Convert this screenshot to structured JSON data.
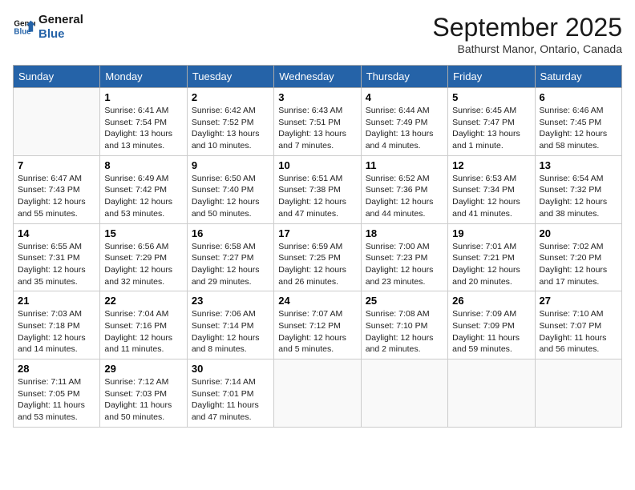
{
  "logo": {
    "line1": "General",
    "line2": "Blue"
  },
  "title": "September 2025",
  "subtitle": "Bathurst Manor, Ontario, Canada",
  "days": [
    "Sunday",
    "Monday",
    "Tuesday",
    "Wednesday",
    "Thursday",
    "Friday",
    "Saturday"
  ],
  "weeks": [
    [
      {
        "date": "",
        "content": ""
      },
      {
        "date": "1",
        "content": "Sunrise: 6:41 AM\nSunset: 7:54 PM\nDaylight: 13 hours\nand 13 minutes."
      },
      {
        "date": "2",
        "content": "Sunrise: 6:42 AM\nSunset: 7:52 PM\nDaylight: 13 hours\nand 10 minutes."
      },
      {
        "date": "3",
        "content": "Sunrise: 6:43 AM\nSunset: 7:51 PM\nDaylight: 13 hours\nand 7 minutes."
      },
      {
        "date": "4",
        "content": "Sunrise: 6:44 AM\nSunset: 7:49 PM\nDaylight: 13 hours\nand 4 minutes."
      },
      {
        "date": "5",
        "content": "Sunrise: 6:45 AM\nSunset: 7:47 PM\nDaylight: 13 hours\nand 1 minute."
      },
      {
        "date": "6",
        "content": "Sunrise: 6:46 AM\nSunset: 7:45 PM\nDaylight: 12 hours\nand 58 minutes."
      }
    ],
    [
      {
        "date": "7",
        "content": "Sunrise: 6:47 AM\nSunset: 7:43 PM\nDaylight: 12 hours\nand 55 minutes."
      },
      {
        "date": "8",
        "content": "Sunrise: 6:49 AM\nSunset: 7:42 PM\nDaylight: 12 hours\nand 53 minutes."
      },
      {
        "date": "9",
        "content": "Sunrise: 6:50 AM\nSunset: 7:40 PM\nDaylight: 12 hours\nand 50 minutes."
      },
      {
        "date": "10",
        "content": "Sunrise: 6:51 AM\nSunset: 7:38 PM\nDaylight: 12 hours\nand 47 minutes."
      },
      {
        "date": "11",
        "content": "Sunrise: 6:52 AM\nSunset: 7:36 PM\nDaylight: 12 hours\nand 44 minutes."
      },
      {
        "date": "12",
        "content": "Sunrise: 6:53 AM\nSunset: 7:34 PM\nDaylight: 12 hours\nand 41 minutes."
      },
      {
        "date": "13",
        "content": "Sunrise: 6:54 AM\nSunset: 7:32 PM\nDaylight: 12 hours\nand 38 minutes."
      }
    ],
    [
      {
        "date": "14",
        "content": "Sunrise: 6:55 AM\nSunset: 7:31 PM\nDaylight: 12 hours\nand 35 minutes."
      },
      {
        "date": "15",
        "content": "Sunrise: 6:56 AM\nSunset: 7:29 PM\nDaylight: 12 hours\nand 32 minutes."
      },
      {
        "date": "16",
        "content": "Sunrise: 6:58 AM\nSunset: 7:27 PM\nDaylight: 12 hours\nand 29 minutes."
      },
      {
        "date": "17",
        "content": "Sunrise: 6:59 AM\nSunset: 7:25 PM\nDaylight: 12 hours\nand 26 minutes."
      },
      {
        "date": "18",
        "content": "Sunrise: 7:00 AM\nSunset: 7:23 PM\nDaylight: 12 hours\nand 23 minutes."
      },
      {
        "date": "19",
        "content": "Sunrise: 7:01 AM\nSunset: 7:21 PM\nDaylight: 12 hours\nand 20 minutes."
      },
      {
        "date": "20",
        "content": "Sunrise: 7:02 AM\nSunset: 7:20 PM\nDaylight: 12 hours\nand 17 minutes."
      }
    ],
    [
      {
        "date": "21",
        "content": "Sunrise: 7:03 AM\nSunset: 7:18 PM\nDaylight: 12 hours\nand 14 minutes."
      },
      {
        "date": "22",
        "content": "Sunrise: 7:04 AM\nSunset: 7:16 PM\nDaylight: 12 hours\nand 11 minutes."
      },
      {
        "date": "23",
        "content": "Sunrise: 7:06 AM\nSunset: 7:14 PM\nDaylight: 12 hours\nand 8 minutes."
      },
      {
        "date": "24",
        "content": "Sunrise: 7:07 AM\nSunset: 7:12 PM\nDaylight: 12 hours\nand 5 minutes."
      },
      {
        "date": "25",
        "content": "Sunrise: 7:08 AM\nSunset: 7:10 PM\nDaylight: 12 hours\nand 2 minutes."
      },
      {
        "date": "26",
        "content": "Sunrise: 7:09 AM\nSunset: 7:09 PM\nDaylight: 11 hours\nand 59 minutes."
      },
      {
        "date": "27",
        "content": "Sunrise: 7:10 AM\nSunset: 7:07 PM\nDaylight: 11 hours\nand 56 minutes."
      }
    ],
    [
      {
        "date": "28",
        "content": "Sunrise: 7:11 AM\nSunset: 7:05 PM\nDaylight: 11 hours\nand 53 minutes."
      },
      {
        "date": "29",
        "content": "Sunrise: 7:12 AM\nSunset: 7:03 PM\nDaylight: 11 hours\nand 50 minutes."
      },
      {
        "date": "30",
        "content": "Sunrise: 7:14 AM\nSunset: 7:01 PM\nDaylight: 11 hours\nand 47 minutes."
      },
      {
        "date": "",
        "content": ""
      },
      {
        "date": "",
        "content": ""
      },
      {
        "date": "",
        "content": ""
      },
      {
        "date": "",
        "content": ""
      }
    ]
  ]
}
